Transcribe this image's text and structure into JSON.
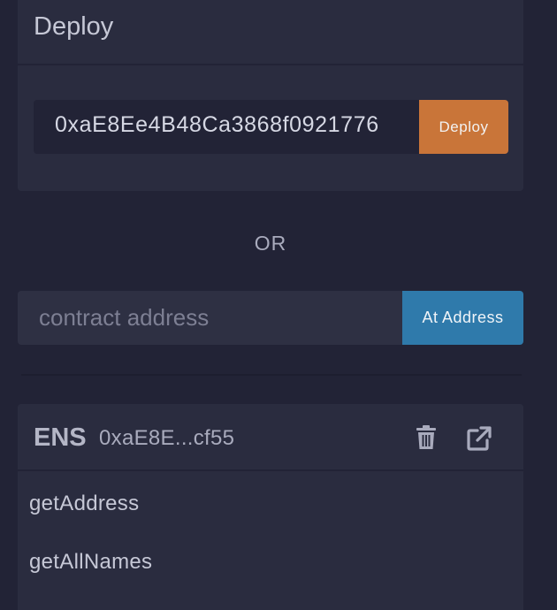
{
  "deploy_section": {
    "title": "Deploy",
    "address_value": "0xaE8Ee4B48Ca3868f0921776",
    "deploy_label": "Deploy"
  },
  "separator": {
    "or_label": "OR"
  },
  "at_address": {
    "placeholder": "contract address",
    "button_label": "At Address"
  },
  "instance": {
    "name": "ENS",
    "address": "0xaE8E...cf55",
    "icons": [
      "trash-icon",
      "external-link-icon"
    ],
    "functions": [
      "getAddress",
      "getAllNames"
    ]
  },
  "colors": {
    "background": "#222336",
    "panel": "#2a2c3f",
    "deploy_button": "#c97539",
    "at_address_button": "#2f7aab"
  }
}
